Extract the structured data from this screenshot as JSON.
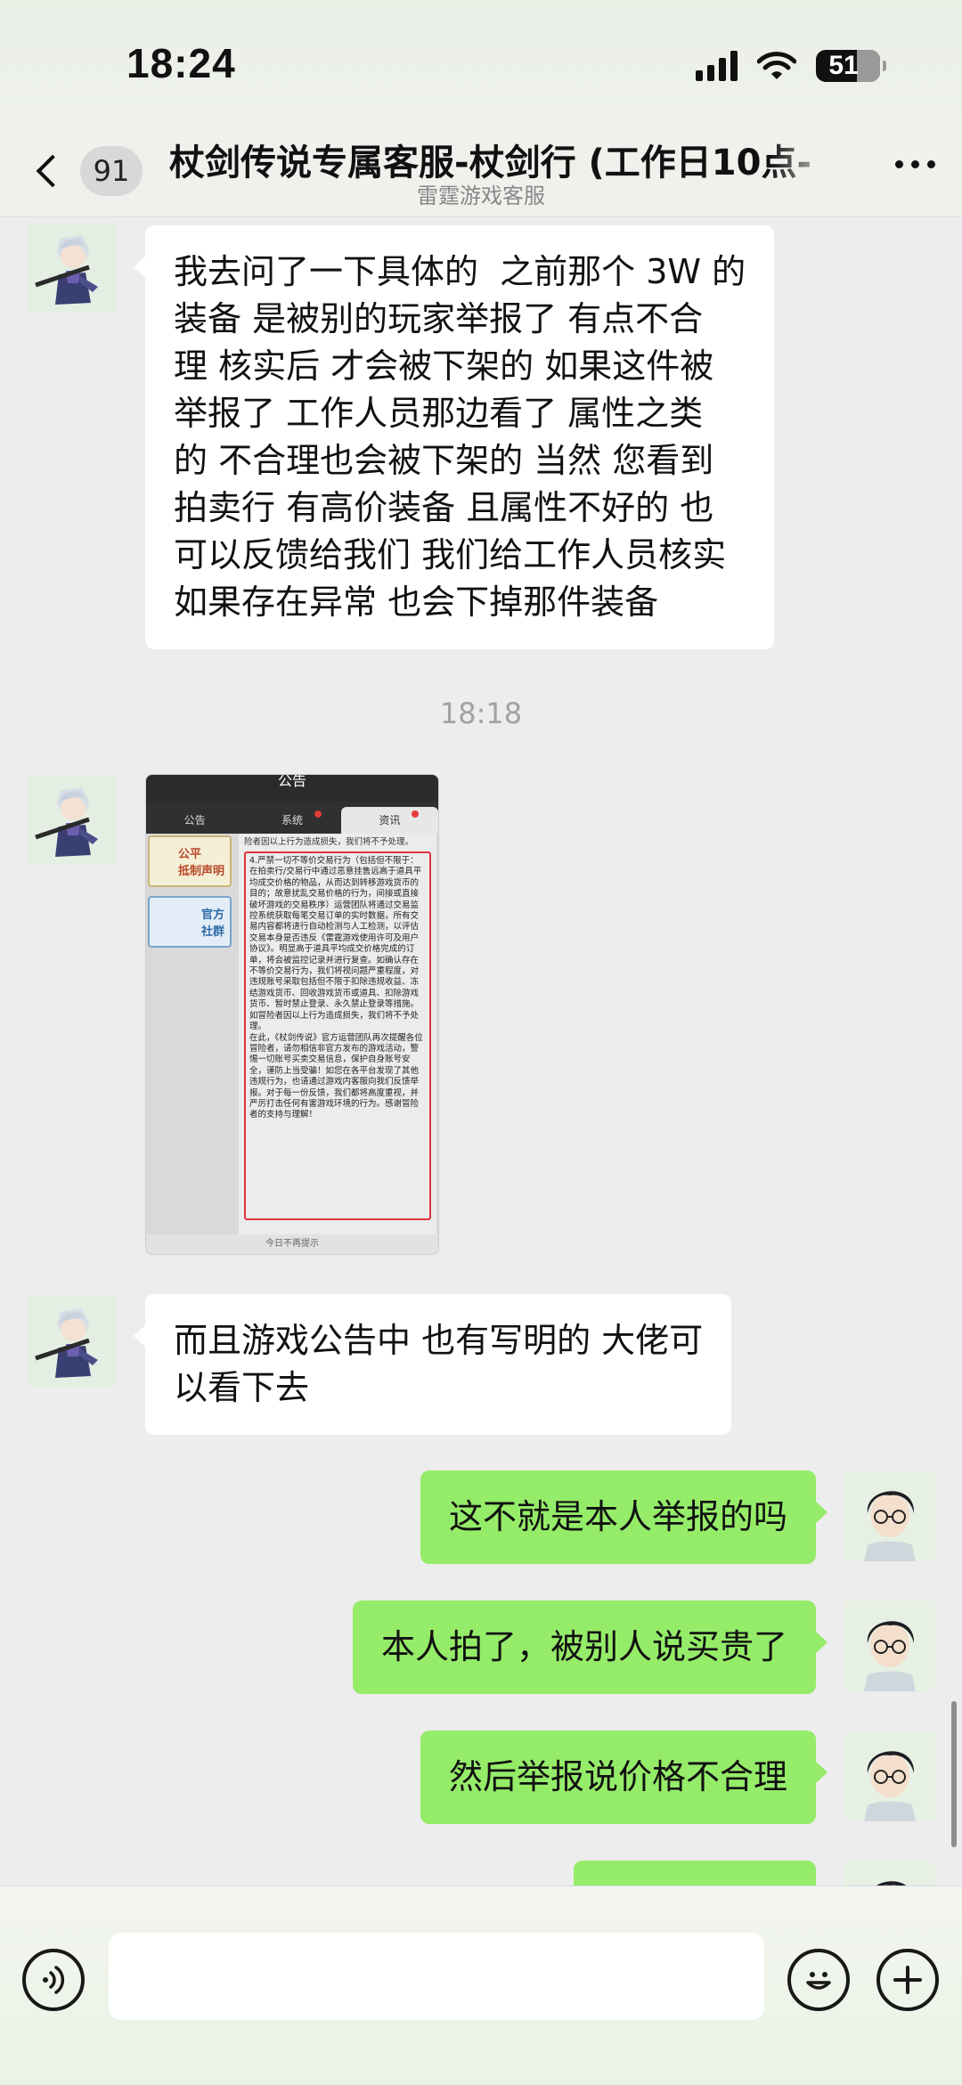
{
  "status_bar": {
    "time": "18:24",
    "battery": "51"
  },
  "nav": {
    "unread_count": "91",
    "title": "杖剑传说专属客服-杖剑行 (工作日10点-",
    "subtitle": "雷霆游戏客服"
  },
  "messages": {
    "m1": "我去问了一下具体的  之前那个 3W 的\n装备 是被别的玩家举报了 有点不合\n理 核实后 才会被下架的 如果这件被\n举报了 工作人员那边看了 属性之类\n的 不合理也会被下架的 当然 您看到\n拍卖行 有高价装备 且属性不好的 也\n可以反馈给我们 我们给工作人员核实\n如果存在异常 也会下掉那件装备",
    "timestamp": "18:18",
    "m3": "而且游戏公告中 也有写明的 大佬可\n以看下去",
    "m4": "这不就是本人举报的吗",
    "m5": "本人拍了，被别人说买贵了",
    "m6": "然后举报说价格不合理"
  },
  "screenshot": {
    "header": "公告",
    "tabs": [
      "公告",
      "系统",
      "资讯"
    ],
    "side_cards": [
      "公平\n抵制声明",
      "官方\n社群"
    ],
    "intro": "险者因以上行为造成损失，我们将不予处理。",
    "notice": "4.严禁一切不等价交易行为（包括但不限于：在拍卖行/交易行中通过恶意挂售远高于道具平均成交价格的物品，从而达到转移游戏货币的目的；故意扰乱交易价格的行为，间接或直接破坏游戏的交易秩序）运营团队将通过交易监控系统获取每笔交易订单的实时数据，所有交易内容都将进行自动检测与人工检测，以评估交易本身是否违反《雷霆游戏使用许可及用户协议》。明显高于道具平均成交价格完成的订单，将会被监控记录并进行复查。如确认存在不等价交易行为，我们将视问题严重程度，对违规账号采取包括但不限于扣除违规收益、冻结游戏货币、回收游戏货币或道具、扣除游戏货币、暂时禁止登录、永久禁止登录等措施。如冒险者因以上行为造成损失，我们将不予处理。\n在此，《杖剑传说》官方运营团队再次提醒各位冒险者，请勿相信非官方发布的游戏活动，警惕一切账号买卖交易信息，保护自身账号安全，谨防上当受骗！如您在各平台发现了其他违规行为，也请通过游戏内客服向我们反馈举报。对于每一份反馈，我们都将高度重视，并严厉打击任何有害游戏环境的行为。感谢冒险者的支持与理解！",
    "footer": "今日不再提示"
  },
  "input": {
    "placeholder": ""
  },
  "colors": {
    "incoming_bubble": "#ffffff",
    "outgoing_bubble": "#95ec69",
    "background": "#ededed"
  }
}
